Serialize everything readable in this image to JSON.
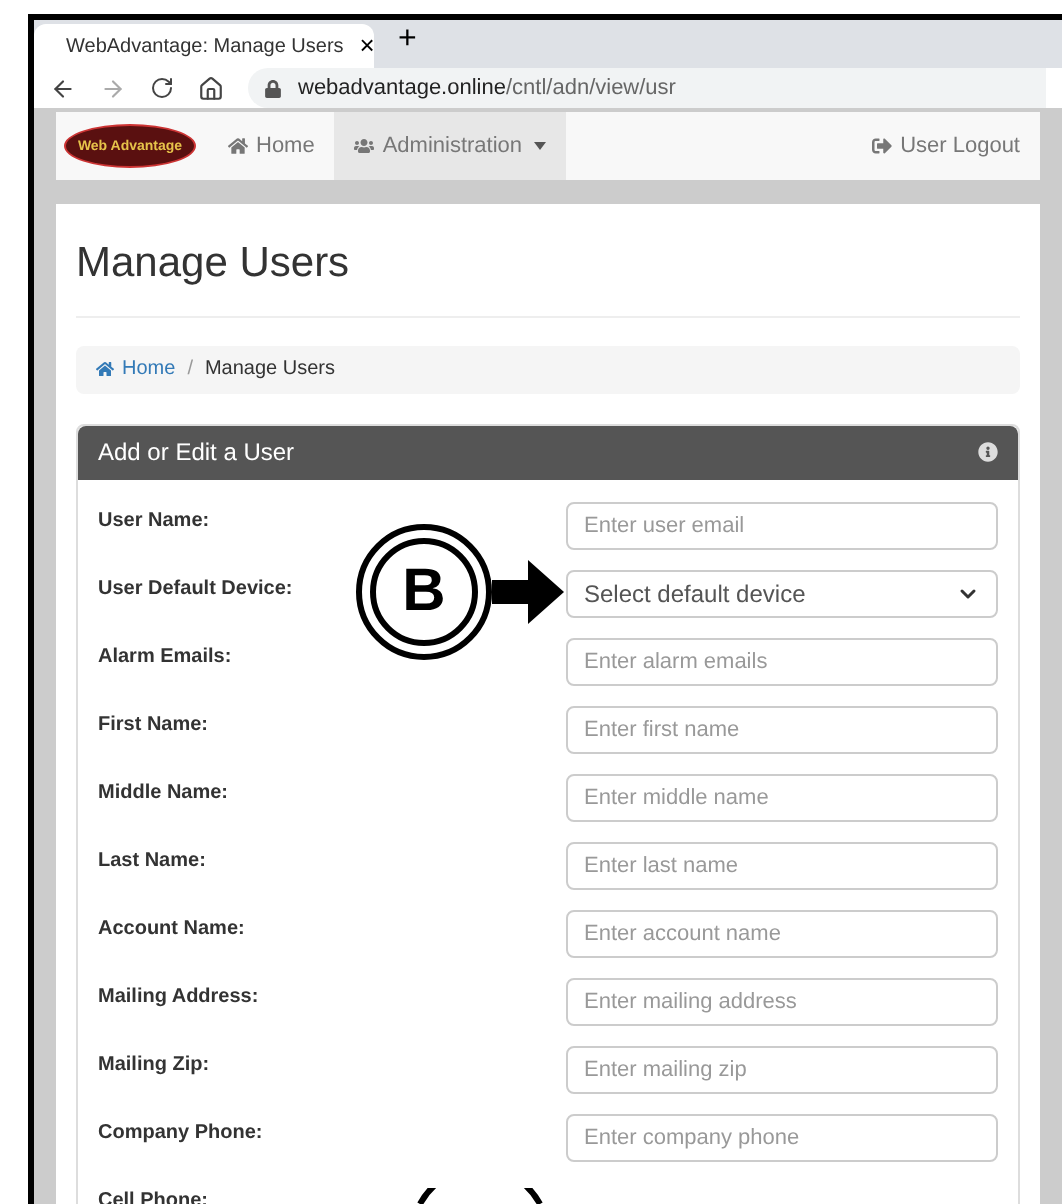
{
  "browser": {
    "tab_title": "WebAdvantage: Manage Users",
    "tab_close": "×",
    "new_tab": "+",
    "url_host": "webadvantage.online",
    "url_path": "/cntl/adn/view/usr"
  },
  "navbar": {
    "logo_text": "Web Advantage",
    "items": [
      {
        "label": "Home",
        "kind": "home",
        "selected": false,
        "dropdown": false
      },
      {
        "label": "Administration",
        "kind": "users",
        "selected": true,
        "dropdown": true
      }
    ],
    "logout": "User Logout"
  },
  "page_title": "Manage Users",
  "breadcrumb": [
    {
      "label": "Home",
      "link": true
    },
    {
      "label": "Manage Users",
      "link": false
    }
  ],
  "breadcrumb_separator": "/",
  "form_panel": {
    "title": "Add or Edit a User",
    "fields": [
      {
        "kind": "text",
        "label": "User Name:",
        "placeholder": "Enter user email"
      },
      {
        "kind": "select",
        "label": "User Default Device:",
        "placeholder": "Select default device"
      },
      {
        "kind": "text",
        "label": "Alarm Emails:",
        "placeholder": "Enter alarm emails"
      },
      {
        "kind": "text",
        "label": "First Name:",
        "placeholder": "Enter first name"
      },
      {
        "kind": "text",
        "label": "Middle Name:",
        "placeholder": "Enter middle name"
      },
      {
        "kind": "text",
        "label": "Last Name:",
        "placeholder": "Enter last name"
      },
      {
        "kind": "text",
        "label": "Account Name:",
        "placeholder": "Enter account name"
      },
      {
        "kind": "text",
        "label": "Mailing Address:",
        "placeholder": "Enter mailing address"
      },
      {
        "kind": "text",
        "label": "Mailing Zip:",
        "placeholder": "Enter mailing zip"
      },
      {
        "kind": "text",
        "label": "Company Phone:",
        "placeholder": "Enter company phone"
      },
      {
        "kind": "none",
        "label": "Cell Phone:"
      }
    ]
  },
  "callout": {
    "letter": "B"
  }
}
